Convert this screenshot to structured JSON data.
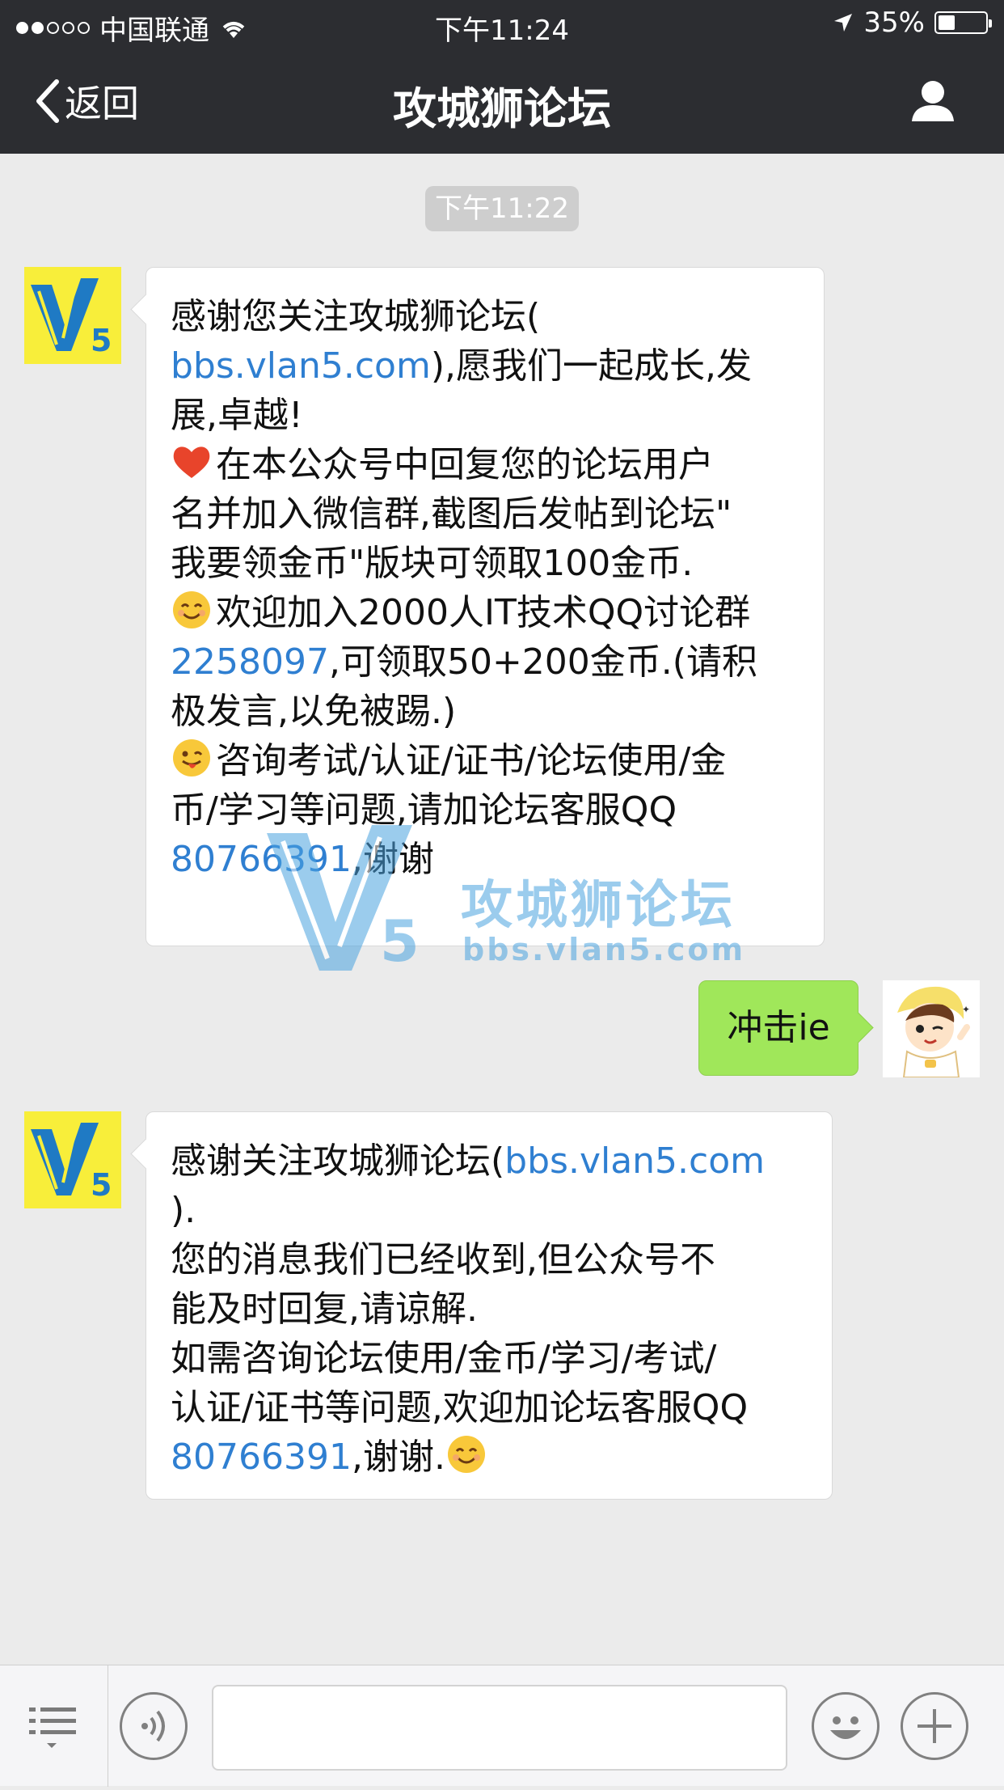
{
  "status_bar": {
    "carrier": "中国联通",
    "time": "下午11:24",
    "battery": "35%",
    "battery_level": 0.35
  },
  "nav": {
    "back_label": "返回",
    "title": "攻城狮论坛"
  },
  "chat": {
    "time_label": "下午11:22",
    "messages": [
      {
        "sender": "account",
        "lines": [
          {
            "segments": [
              {
                "text": "感谢您关注攻城狮论坛("
              }
            ]
          },
          {
            "segments": [
              {
                "text": "bbs.vlan5.com",
                "link": true
              },
              {
                "text": "),愿我们一起成长,发"
              }
            ]
          },
          {
            "segments": [
              {
                "text": "展,卓越!"
              }
            ]
          },
          {
            "segments": [
              {
                "text": " "
              }
            ]
          },
          {
            "emoji": "heart",
            "segments": [
              {
                "text": "在本公众号中回复您的论坛用户"
              }
            ]
          },
          {
            "segments": [
              {
                "text": "名并加入微信群,截图后发帖到论坛\""
              }
            ]
          },
          {
            "segments": [
              {
                "text": "我要领金币\"版块可领取100金币."
              }
            ]
          },
          {
            "emoji": "smile",
            "segments": [
              {
                "text": "欢迎加入2000人IT技术QQ讨论群"
              }
            ]
          },
          {
            "segments": [
              {
                "text": "2258097",
                "link": true
              },
              {
                "text": ",可领取50+200金币.(请积"
              }
            ]
          },
          {
            "segments": [
              {
                "text": "极发言,以免被踢.)"
              }
            ]
          },
          {
            "emoji": "wink",
            "segments": [
              {
                "text": "咨询考试/认证/证书/论坛使用/金"
              }
            ]
          },
          {
            "segments": [
              {
                "text": "币/学习等问题,请加论坛客服QQ"
              }
            ]
          },
          {
            "segments": [
              {
                "text": "80766391",
                "link": true
              },
              {
                "text": ",谢谢"
              }
            ]
          }
        ]
      },
      {
        "sender": "me",
        "text": "冲击ie"
      },
      {
        "sender": "account",
        "lines": [
          {
            "segments": [
              {
                "text": "感谢关注攻城狮论坛("
              },
              {
                "text": "bbs.vlan5.com",
                "link": true
              }
            ]
          },
          {
            "segments": [
              {
                "text": ")."
              }
            ]
          },
          {
            "segments": [
              {
                "text": "您的消息我们已经收到,但公众号不"
              }
            ]
          },
          {
            "segments": [
              {
                "text": "能及时回复,请谅解."
              }
            ]
          },
          {
            "segments": [
              {
                "text": "如需咨询论坛使用/金币/学习/考试/"
              }
            ]
          },
          {
            "segments": [
              {
                "text": "认证/证书等问题,欢迎加论坛客服QQ"
              }
            ]
          },
          {
            "segments": [
              {
                "text": "80766391",
                "link": true
              },
              {
                "text": ",谢谢."
              }
            ],
            "emoji_end": "smile"
          }
        ]
      }
    ]
  },
  "watermark": {
    "title": "攻城狮论坛",
    "url": "bbs.vlan5.com"
  },
  "input": {
    "placeholder": ""
  },
  "colors": {
    "nav_bg": "#2c2d31",
    "chat_bg": "#ebebeb",
    "link": "#2f7fd1",
    "my_bubble": "#a0e75a",
    "avatar_yellow": "#f8ee3a"
  },
  "icons": {
    "signal": "signal-dots-icon",
    "wifi": "wifi-icon",
    "location": "location-arrow-icon",
    "battery": "battery-icon",
    "back": "chevron-left-icon",
    "profile": "person-icon",
    "menu": "menu-list-icon",
    "voice": "voice-icon",
    "emoji": "emoji-icon",
    "plus": "plus-icon"
  }
}
